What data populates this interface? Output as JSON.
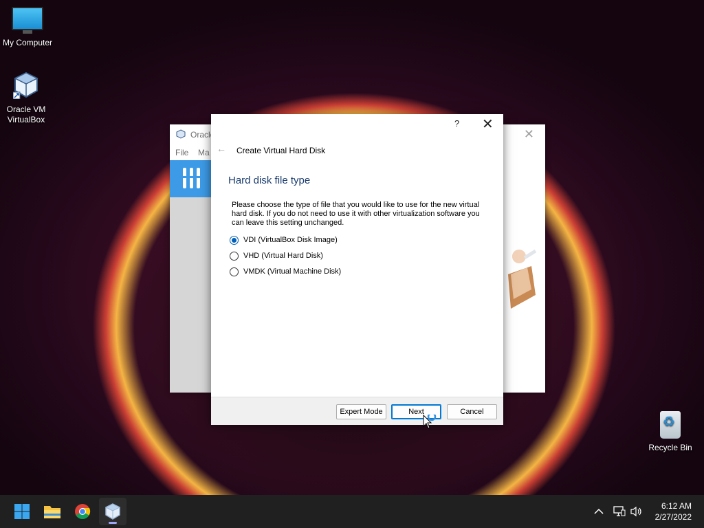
{
  "desktop": {
    "icons": [
      {
        "label": "My Computer"
      },
      {
        "label": "Oracle VM\nVirtualBox"
      },
      {
        "label": "Recycle Bin"
      }
    ]
  },
  "background_window": {
    "title": "Oracle",
    "menu": [
      "File",
      "Ma"
    ]
  },
  "dialog": {
    "help": "?",
    "close": "✕",
    "back": "←",
    "title": "Create Virtual Hard Disk",
    "heading": "Hard disk file type",
    "description": "Please choose the type of file that you would like to use for the new virtual hard disk. If you do not need to use it with other virtualization software you can leave this setting unchanged.",
    "options": [
      {
        "label": "VDI (VirtualBox Disk Image)",
        "checked": true
      },
      {
        "label": "VHD (Virtual Hard Disk)",
        "checked": false
      },
      {
        "label": "VMDK (Virtual Machine Disk)",
        "checked": false
      }
    ],
    "buttons": {
      "expert": "Expert Mode",
      "next": "Next",
      "cancel": "Cancel"
    }
  },
  "taskbar": {
    "apps": [
      "start-icon",
      "file-explorer-icon",
      "chrome-icon",
      "virtualbox-icon"
    ],
    "clock": {
      "time": "6:12 AM",
      "date": "2/27/2022"
    }
  },
  "colors": {
    "accent": "#0078d4",
    "heading": "#1a3c6e",
    "taskbar": "#202020",
    "vbox_blue": "#3d9ae6"
  }
}
